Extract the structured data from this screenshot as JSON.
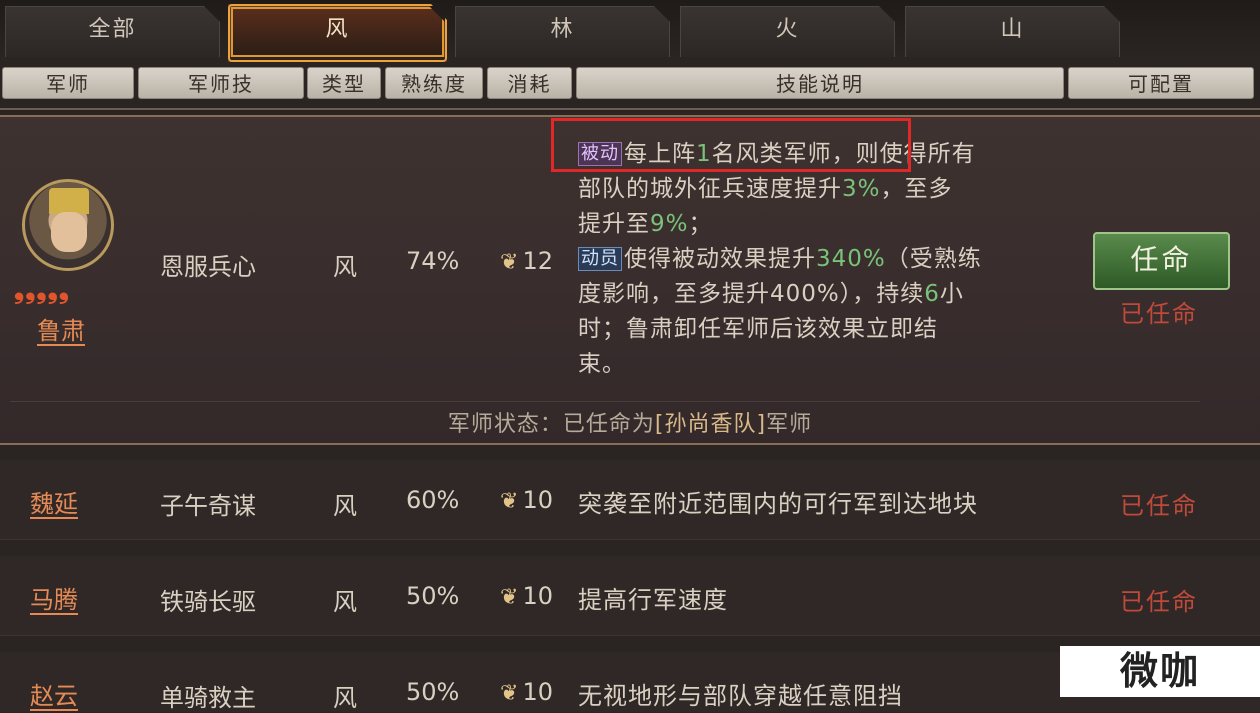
{
  "tabs": [
    "全部",
    "风",
    "林",
    "火",
    "山"
  ],
  "active_tab": "风",
  "headers": {
    "advisor": "军师",
    "skill": "军师技",
    "type": "类型",
    "proficiency": "熟练度",
    "cost": "消耗",
    "description": "技能说明",
    "configurable": "可配置"
  },
  "main_row": {
    "stars": "❟❟❟❟❟",
    "name": "鲁肃",
    "skill": "恩服兵心",
    "type": "风",
    "proficiency": "74%",
    "cost": "12",
    "tag_passive": "被动",
    "desc_l1a": "每上阵",
    "desc_l1n": "1",
    "desc_l1b": "名风类军师，则使得所有",
    "desc_l2a": "部队的城外征兵速度提升",
    "desc_l2n": "3%",
    "desc_l2b": "，至多",
    "desc_l3a": "提升至",
    "desc_l3n": "9%",
    "desc_l3b": "；",
    "tag_active": "动员",
    "desc_l4a": "使得被动效果提升",
    "desc_l4n": "340%",
    "desc_l4b": "（受熟练",
    "desc_l5a": "度影响，至多提升400%），持续",
    "desc_l5n": "6",
    "desc_l5b": "小",
    "desc_l6": "时；鲁肃卸任军师后该效果立即结",
    "desc_l7": "束。",
    "button": "任命",
    "appointed": "已任命",
    "status_prefix": "军师状态：已任命为",
    "status_team": "[孙尚香队]",
    "status_suffix": "军师"
  },
  "rows": [
    {
      "name": "魏延",
      "skill": "子午奇谋",
      "type": "风",
      "proficiency": "60%",
      "cost": "10",
      "desc": "突袭至附近范围内的可行军到达地块",
      "status": "已任命"
    },
    {
      "name": "马腾",
      "skill": "铁骑长驱",
      "type": "风",
      "proficiency": "50%",
      "cost": "10",
      "desc": "提高行军速度",
      "status": "已任命"
    },
    {
      "name": "赵云",
      "skill": "单骑救主",
      "type": "风",
      "proficiency": "50%",
      "cost": "10",
      "desc": "无视地形与部队穿越任意阻挡",
      "status": ""
    }
  ],
  "watermark": "微咖",
  "colors": {
    "accent": "#f0a23a",
    "green_num": "#7ac27a",
    "name": "#e58a55",
    "appointed": "#c04a3a",
    "highlight_box": "#e02828"
  }
}
